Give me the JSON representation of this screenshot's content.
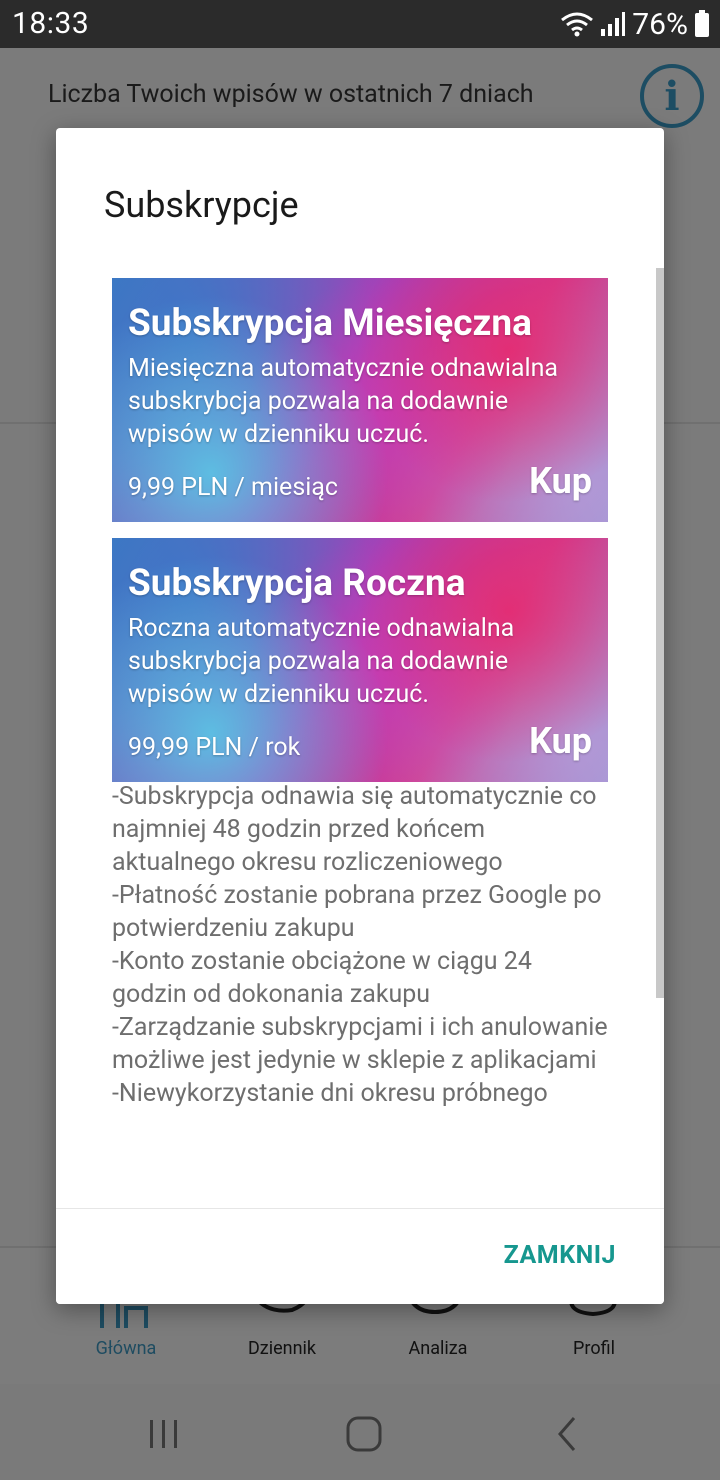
{
  "status_bar": {
    "time": "18:33",
    "battery": "76%"
  },
  "background_app": {
    "header_title": "Liczba Twoich wpisów w ostatnich 7 dniach",
    "info_icon": "info-icon",
    "bottom_nav": [
      {
        "label": "Główna",
        "icon": "home-icon",
        "active": true
      },
      {
        "label": "Dziennik",
        "icon": "journal-icon",
        "active": false
      },
      {
        "label": "Analiza",
        "icon": "analysis-icon",
        "active": false
      },
      {
        "label": "Profil",
        "icon": "profile-icon",
        "active": false
      }
    ]
  },
  "dialog": {
    "title": "Subskrypcje",
    "cards": [
      {
        "title": "Subskrypcja Miesięczna",
        "description": "Miesięczna automatycznie odnawialna subskrybcja pozwala na dodawnie wpisów w dzienniku uczuć.",
        "price": "9,99 PLN / miesiąc",
        "buy_label": "Kup"
      },
      {
        "title": "Subskrypcja Roczna",
        "description": "Roczna automatycznie odnawialna subskrybcja pozwala na dodawnie wpisów w dzienniku uczuć.",
        "price": "99,99 PLN / rok",
        "buy_label": "Kup"
      }
    ],
    "terms": [
      "-Subskrypcja odnawia się automatycznie co najmniej 48 godzin przed końcem aktualnego okresu rozliczeniowego",
      "-Płatność zostanie pobrana przez Google po potwierdzeniu zakupu",
      "-Konto zostanie obciążone w ciągu 24 godzin od dokonania zakupu",
      "-Zarządzanie subskrypcjami i ich anulowanie możliwe jest jedynie w sklepie z aplikacjami",
      "-Niewykorzystanie dni okresu próbnego"
    ],
    "close_label": "ZAMKNIJ"
  },
  "colors": {
    "accent_teal": "#16978f",
    "nav_active": "#1e4c61",
    "terms_text": "#6e6e6e"
  }
}
